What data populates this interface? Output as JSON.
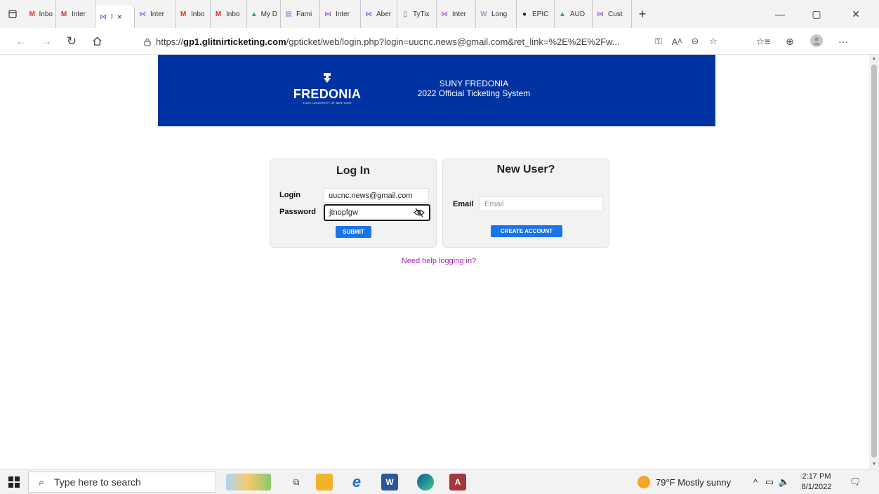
{
  "browser": {
    "tabs": [
      {
        "icon": "gmail-icon",
        "label": "Inbo",
        "color": "#d93025"
      },
      {
        "icon": "gmail-icon",
        "label": "Inter",
        "color": "#d93025"
      },
      {
        "icon": "site-icon",
        "label": "I",
        "active": true,
        "close": "×"
      },
      {
        "icon": "site-icon",
        "label": "Inter"
      },
      {
        "icon": "gmail-icon",
        "label": "Inbo",
        "color": "#d93025"
      },
      {
        "icon": "gmail-icon",
        "label": "Inbo",
        "color": "#d93025"
      },
      {
        "icon": "drive-icon",
        "label": "My D"
      },
      {
        "icon": "docs-icon",
        "label": "Fami"
      },
      {
        "icon": "site-icon",
        "label": "Inter"
      },
      {
        "icon": "site-icon",
        "label": "Aber"
      },
      {
        "icon": "page-icon",
        "label": "TyTix"
      },
      {
        "icon": "site-icon",
        "label": "Inter"
      },
      {
        "icon": "wordpress-icon",
        "label": "Long"
      },
      {
        "icon": "epic-icon",
        "label": "EPIC"
      },
      {
        "icon": "drive-icon",
        "label": "AUD"
      },
      {
        "icon": "site-icon",
        "label": "Cust"
      }
    ],
    "new_tab": "+",
    "url_prefix": "https://",
    "url_host": "gp1.glitnirticketing.com",
    "url_rest": "/gpticket/web/login.php?login=uucnc.news@gmail.com&ret_link=%2E%2E%2Fw..."
  },
  "page": {
    "banner": {
      "logo_name": "FREDONIA",
      "logo_tag": "STATE UNIVERSITY OF NEW YORK",
      "line1": "SUNY FREDONIA",
      "line2": "2022 Official Ticketing System",
      "bg": "#0033a1"
    },
    "login": {
      "title": "Log In",
      "login_label": "Login",
      "login_value": "uucnc.news@gmail.com",
      "password_label": "Password",
      "password_value": "jtnopfgw",
      "submit_label": "SUBMIT"
    },
    "new_user": {
      "title": "New User?",
      "email_label": "Email",
      "email_placeholder": "Email",
      "create_label": "CREATE ACCOUNT"
    },
    "help_link": "Need help logging in?"
  },
  "taskbar": {
    "search_placeholder": "Type here to search",
    "weather": "79°F  Mostly sunny",
    "time": "2:17 PM",
    "date": "8/1/2022"
  }
}
